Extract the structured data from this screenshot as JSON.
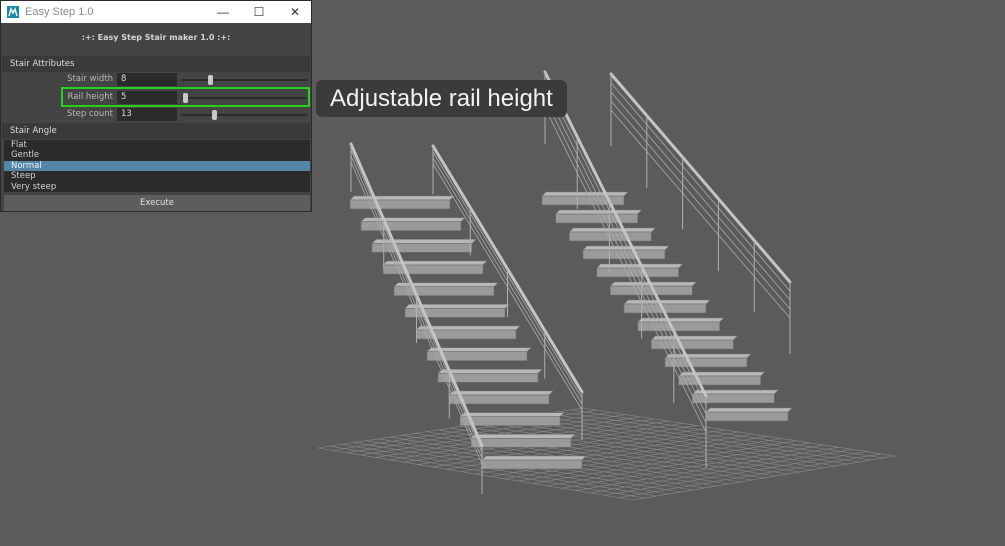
{
  "window": {
    "title": "Easy Step 1.0",
    "header": ":+:  Easy Step Stair maker 1.0  :+:",
    "controls": {
      "minimize": "—",
      "maximize": "☐",
      "close": "✕"
    }
  },
  "attributes": {
    "section_label": "Stair Attributes",
    "stair_width": {
      "label": "Stair width",
      "value": "8",
      "slider_fraction": 0.22
    },
    "rail_height": {
      "label": "Rail height",
      "value": "5",
      "slider_fraction": 0.02
    },
    "step_count": {
      "label": "Step count",
      "value": "13",
      "slider_fraction": 0.26
    }
  },
  "angle": {
    "section_label": "Stair Angle",
    "options": [
      "Flat",
      "Gentle",
      "Normal",
      "Steep",
      "Very steep"
    ],
    "selected": "Normal"
  },
  "execute_label": "Execute",
  "tooltip": "Adjustable rail height",
  "colors": {
    "highlight": "#27d11b",
    "selection": "#5285a6",
    "viewport": "#5b5b5b"
  }
}
